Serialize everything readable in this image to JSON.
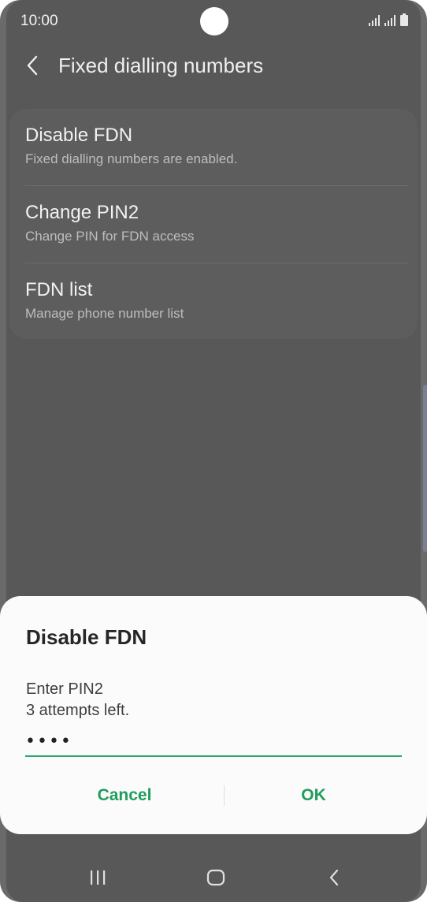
{
  "status_bar": {
    "time": "10:00"
  },
  "header": {
    "title": "Fixed dialling numbers"
  },
  "settings": {
    "items": [
      {
        "title": "Disable FDN",
        "subtitle": "Fixed dialling numbers are enabled."
      },
      {
        "title": "Change PIN2",
        "subtitle": "Change PIN for FDN access"
      },
      {
        "title": "FDN list",
        "subtitle": "Manage phone number list"
      }
    ]
  },
  "dialog": {
    "title": "Disable FDN",
    "message_line1": "Enter PIN2",
    "message_line2": "3 attempts left.",
    "pin_value": "••••",
    "cancel_label": "Cancel",
    "ok_label": "OK"
  },
  "colors": {
    "accent": "#1f9d5c",
    "dimmed_background": "#585858",
    "dialog_background": "#fbfbfb"
  },
  "icons": {
    "back": "chevron-left-icon",
    "signal": "signal-icon",
    "battery": "battery-icon",
    "recents": "recents-icon",
    "home": "home-icon",
    "nav_back": "nav-back-icon"
  }
}
